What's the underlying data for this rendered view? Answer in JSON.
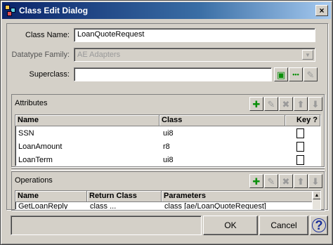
{
  "window": {
    "title": "Class Edit Dialog",
    "close_glyph": "×",
    "app_icon": "class-dialog-icon"
  },
  "form": {
    "class_name_label": "Class Name:",
    "class_name_value": "LoanQuoteRequest",
    "datatype_family_label": "Datatype Family:",
    "datatype_family_value": "AE Adapters",
    "superclass_label": "Superclass:",
    "superclass_value": "",
    "superclass_buttons": [
      {
        "icon": "browse-icon",
        "glyph": "▣"
      },
      {
        "icon": "more-icon",
        "glyph": "•••"
      },
      {
        "icon": "edit-icon",
        "glyph": "✎"
      }
    ]
  },
  "toolbar_glyphs": {
    "add": "✚",
    "edit": "✎",
    "delete": "✖",
    "up": "⬆",
    "down": "⬇"
  },
  "attributes": {
    "title": "Attributes",
    "columns": [
      "Name",
      "Class",
      "Key ?"
    ],
    "rows": [
      {
        "name": "SSN",
        "class": "ui8",
        "key": false
      },
      {
        "name": "LoanAmount",
        "class": "r8",
        "key": false
      },
      {
        "name": "LoanTerm",
        "class": "ui8",
        "key": false
      }
    ]
  },
  "operations": {
    "title": "Operations",
    "columns": [
      "Name",
      "Return Class",
      "Parameters"
    ],
    "rows": [
      {
        "name": "GetLoanReply",
        "return_class": "class ...",
        "parameters": "class [ae/LoanQuoteRequest]"
      }
    ]
  },
  "buttons": {
    "ok": "OK",
    "cancel": "Cancel",
    "help": "?"
  },
  "colors": {
    "title_start": "#0a246a",
    "title_end": "#a6caf0",
    "add_green": "#0a8f0a",
    "dialog_bg": "#d4d0c8"
  }
}
